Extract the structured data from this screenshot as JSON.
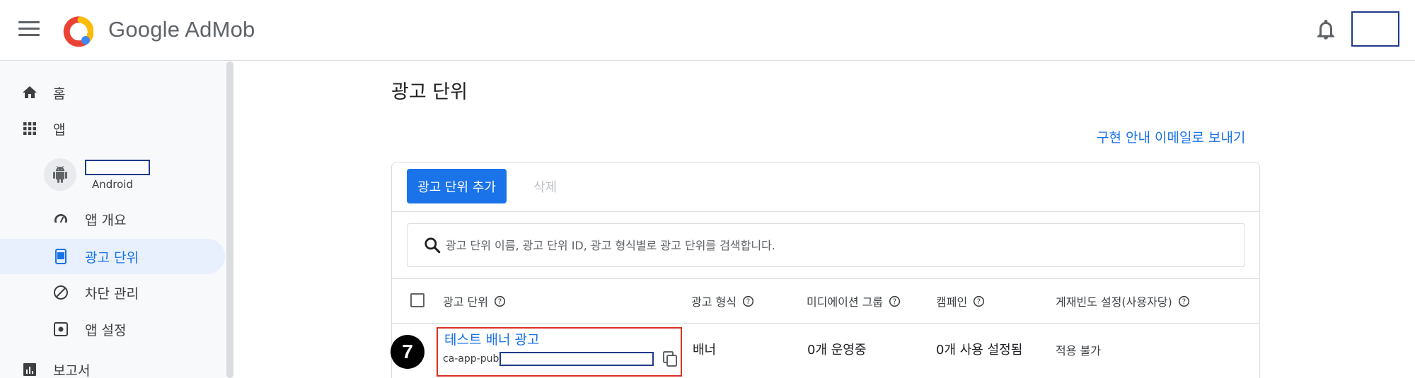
{
  "header": {
    "brand": "Google AdMob",
    "menu_icon": "hamburger-menu-icon",
    "notifications_icon": "bell-icon"
  },
  "sidebar": {
    "home": "홈",
    "apps": "앱",
    "app": {
      "platform": "Android"
    },
    "app_overview": "앱 개요",
    "ad_units": "광고 단위",
    "blocking": "차단 관리",
    "app_settings": "앱 설정",
    "reports": "보고서"
  },
  "main": {
    "title": "광고 단위",
    "email_link": "구현 안내 이메일로 보내기",
    "add_button": "광고 단위 추가",
    "delete_button": "삭제",
    "search_placeholder": "광고 단위 이름, 광고 단위 ID, 광고 형식별로 광고 단위를 검색합니다.",
    "columns": [
      "광고 단위",
      "광고 형식",
      "미디에이션 그룹",
      "캠페인",
      "게재빈도 설정(사용자당)"
    ],
    "rows": [
      {
        "name": "테스트 배너 광고",
        "id_prefix": "ca-app-pub-",
        "format": "배너",
        "mediation": "0개 운영중",
        "campaign": "0개 사용 설정됨",
        "frequency": "적용 불가"
      }
    ]
  },
  "annotation": {
    "step": "7"
  },
  "colors": {
    "accent": "#1a73e8",
    "highlight": "#d93025",
    "redacted_border": "#1f3c88"
  }
}
